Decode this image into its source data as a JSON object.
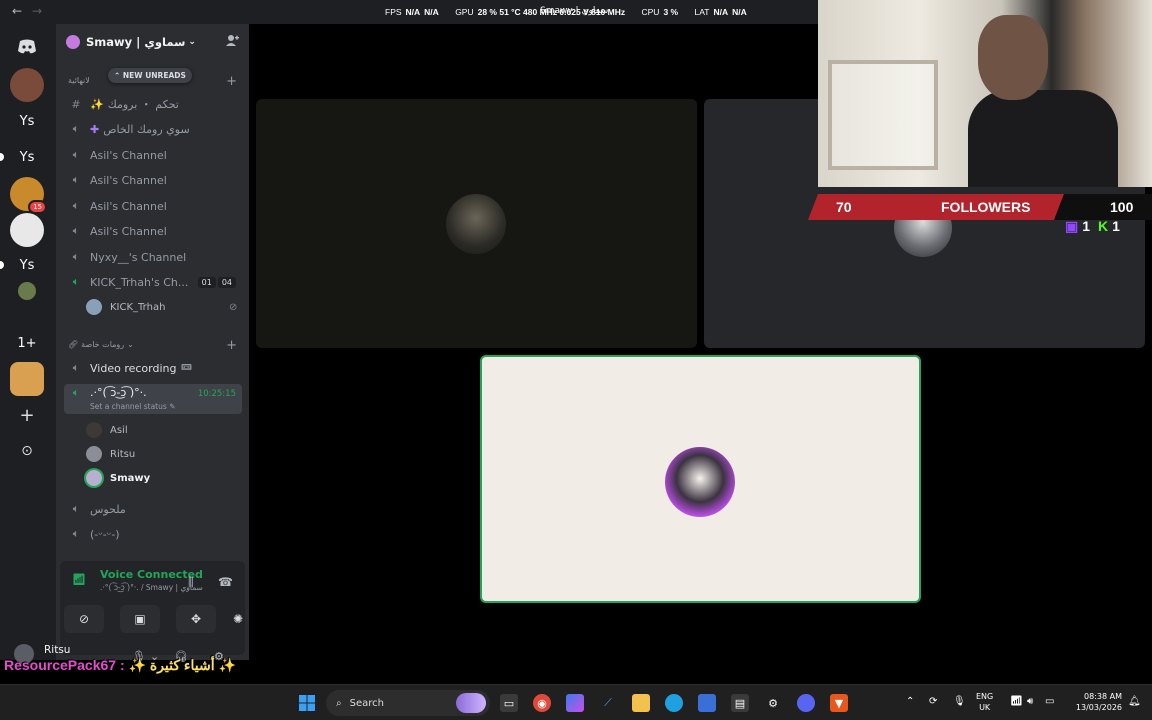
{
  "topbar": {
    "back": "←",
    "forward": "→",
    "window_title": "Smawy | سماوي"
  },
  "overlay": {
    "fps_label": "FPS",
    "fps_val1": "N/A",
    "fps_val2": "N/A",
    "gpu_label": "GPU",
    "gpu_text": "28 % 51 °C 480 MHz 0.625 V 810 MHz",
    "cpu_label": "CPU",
    "cpu_val": "3 %",
    "lat_label": "LAT",
    "lat_val1": "N/A",
    "lat_val2": "N/A"
  },
  "rail": {
    "servers": [
      {
        "label": "",
        "icon": "discord-home-icon"
      },
      {
        "label": "",
        "icon": "avatar"
      },
      {
        "label": "Ys"
      },
      {
        "label": "Ys"
      },
      {
        "label": "",
        "badge": "15"
      },
      {
        "label": ""
      },
      {
        "label": "Ys"
      },
      {
        "label": ""
      },
      {
        "label": "1+"
      },
      {
        "label": ""
      },
      {
        "label": "+",
        "icon": "add-server-icon"
      },
      {
        "label": "⊙",
        "icon": "discover-icon"
      }
    ]
  },
  "server": {
    "name": "Smawy | سماوي",
    "chevron": "⌄",
    "invite_icon": "add-member-icon"
  },
  "new_unreads": "NEW UNREADS",
  "categories": {
    "first": "لانهائية",
    "private": "رومات خاصة"
  },
  "channels": [
    {
      "name": "تحكم ・ برومك",
      "icon": "#"
    },
    {
      "name": "سوي رومك الخاص",
      "icon": "🔊"
    },
    {
      "name": "Asil's Channel",
      "icon": "🔊"
    },
    {
      "name": "Asil's Channel",
      "icon": "🔊"
    },
    {
      "name": "Asil's Channel",
      "icon": "🔊"
    },
    {
      "name": "Asil's Channel",
      "icon": "🔊"
    },
    {
      "name": "Nyxy__'s Channel",
      "icon": "🔊"
    },
    {
      "name": "KICK_Trhah's Ch...",
      "icon": "🔊",
      "badge1": "01",
      "badge2": "04"
    }
  ],
  "kick_user": "KICK_Trhah",
  "private_channels": [
    {
      "name": "Video recording",
      "icon": "🔊"
    },
    {
      "name": ".·°( ͡ↄ-͜ↄ͡ )°·.",
      "icon": "🔊",
      "timer": "10:25:15",
      "sub": "Set a channel status"
    },
    {
      "name": "ملحوس",
      "icon": "🔊"
    },
    {
      "name": "(-ᵕ-ᵕ-)",
      "icon": "🔊"
    }
  ],
  "voice_users": [
    "Asil",
    "Ritsu",
    "Smawy"
  ],
  "voice_panel": {
    "status": "Voice Connected",
    "sub": ".·°( ͡ↄ-͜ↄ͡ )°·. / Smawy | سماوي"
  },
  "user": {
    "name": "Ritsu"
  },
  "ticker": {
    "text": "ResourcePack67",
    "sep": " : ",
    "arabic": "✨ أشياء كثيرة ✨"
  },
  "follow_bar": {
    "count": "70",
    "label": "FOLLOWERS",
    "goal": "100"
  },
  "viewers": {
    "twitch": "1",
    "kick": "1"
  },
  "taskbar": {
    "search": "Search",
    "lang1": "ENG",
    "lang2": "UK",
    "time": "08:38 AM",
    "date": "13/03/2026"
  }
}
